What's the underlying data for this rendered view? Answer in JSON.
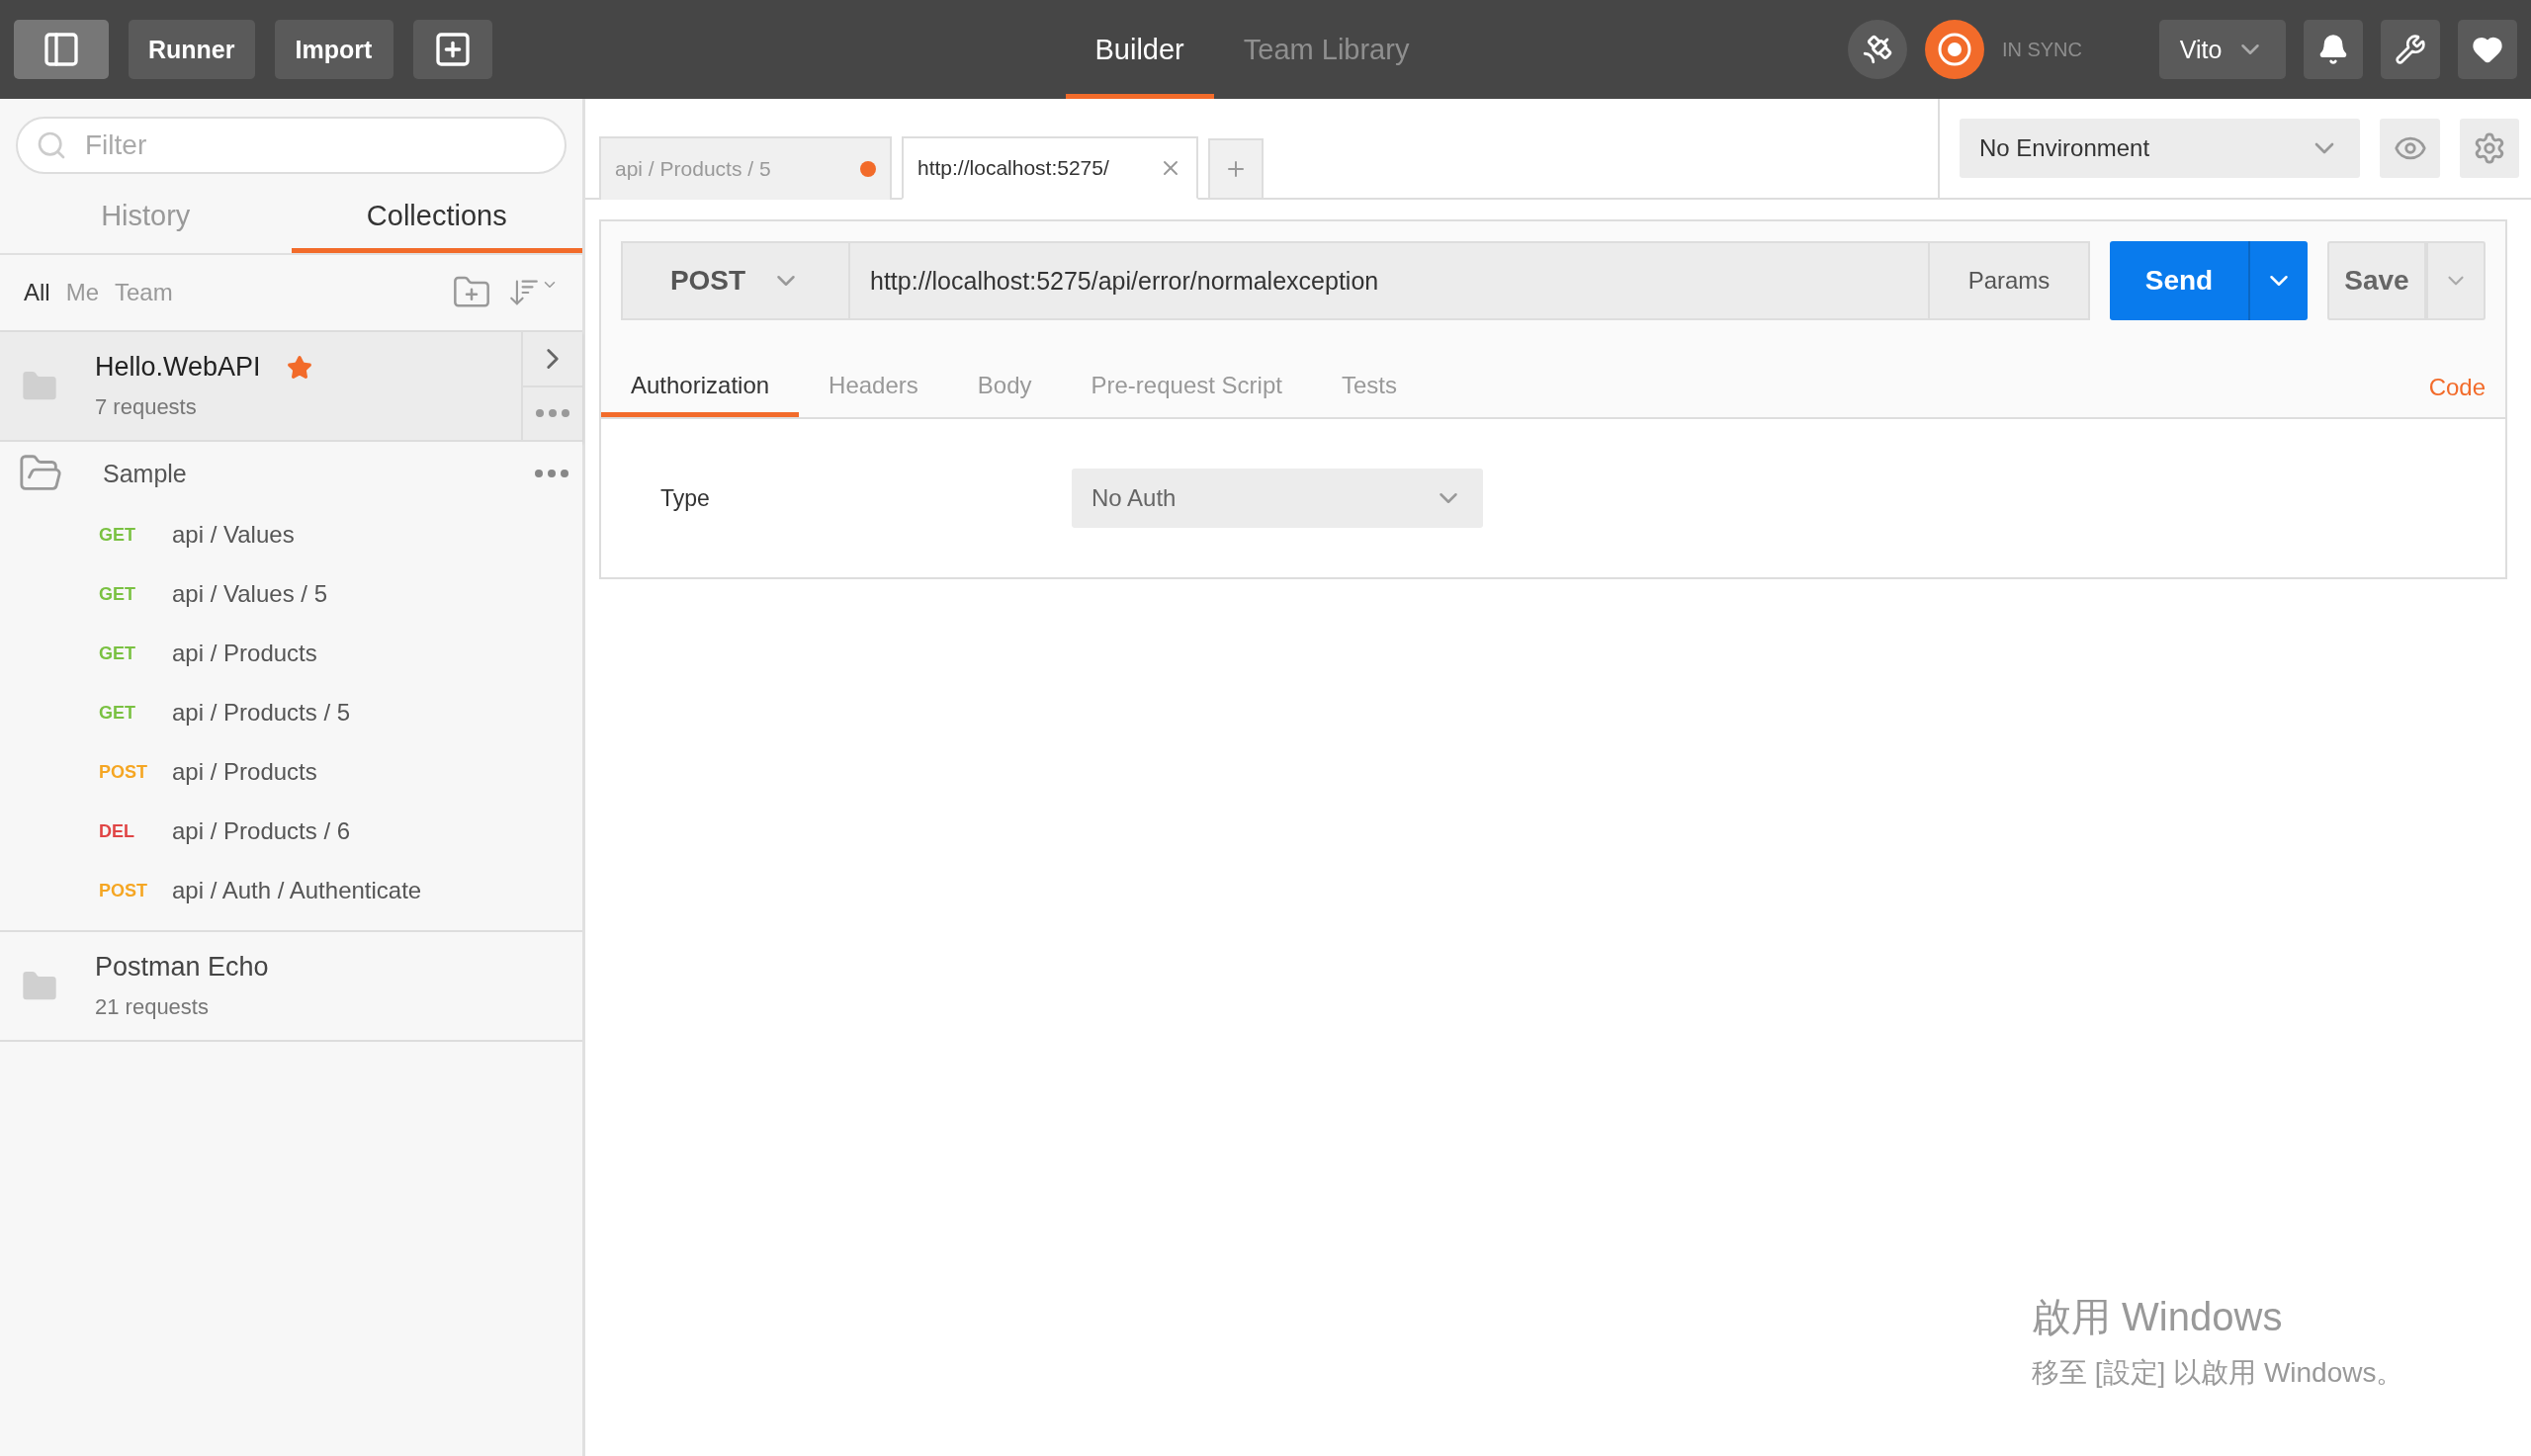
{
  "toolbar": {
    "buttons": [
      "Runner",
      "Import"
    ]
  },
  "nav_tabs": [
    {
      "label": "Builder",
      "selected": true
    },
    {
      "label": "Team Library",
      "selected": false
    }
  ],
  "sync_status": "IN SYNC",
  "user": "Vito",
  "sidebar": {
    "search": {
      "placeholder": "Filter"
    },
    "tabs": [
      {
        "label": "History",
        "selected": false
      },
      {
        "label": "Collections",
        "selected": true
      }
    ],
    "filters": [
      {
        "label": "All",
        "selected": true
      },
      {
        "label": "Me",
        "selected": false
      },
      {
        "label": "Team",
        "selected": false
      }
    ],
    "collections": [
      {
        "name": "Hello.WebAPI",
        "meta": "7 requests",
        "starred": true,
        "selected": true,
        "expanded": false
      },
      {
        "name": "Sample",
        "starred": false,
        "selected": false,
        "expanded": true,
        "requests": [
          {
            "method": "GET",
            "color": "#7ac142",
            "path": "api / Values"
          },
          {
            "method": "GET",
            "color": "#7ac142",
            "path": "api / Values / 5"
          },
          {
            "method": "GET",
            "color": "#7ac142",
            "path": "api / Products"
          },
          {
            "method": "GET",
            "color": "#7ac142",
            "path": "api / Products / 5"
          },
          {
            "method": "POST",
            "color": "#f5a623",
            "path": "api / Products"
          },
          {
            "method": "DEL",
            "color": "#e04545",
            "path": "api / Products / 6"
          },
          {
            "method": "POST",
            "color": "#f5a623",
            "path": "api / Auth / Authenticate"
          }
        ]
      },
      {
        "name": "Postman Echo",
        "meta": "21 requests",
        "starred": false,
        "selected": false,
        "expanded": false
      }
    ]
  },
  "request_tabs": [
    {
      "label": "api / Products / 5",
      "selected": false,
      "unsaved": true
    },
    {
      "label": "http://localhost:5275/",
      "selected": true,
      "unsaved": false
    }
  ],
  "environment": "No Environment",
  "request": {
    "method": "POST",
    "url": "http://localhost:5275/api/error/normalexception",
    "params_button": "Params",
    "send_button": "Send",
    "save_button": "Save",
    "tabs": [
      {
        "label": "Authorization",
        "selected": true
      },
      {
        "label": "Headers",
        "selected": false
      },
      {
        "label": "Body",
        "selected": false
      },
      {
        "label": "Pre-request Script",
        "selected": false
      },
      {
        "label": "Tests",
        "selected": false
      }
    ],
    "code_link": "Code",
    "auth": {
      "label": "Type",
      "value": "No Auth"
    }
  },
  "system_notice": {
    "title": "啟用 Windows",
    "message": "移至 [設定] 以啟用 Windows。"
  }
}
